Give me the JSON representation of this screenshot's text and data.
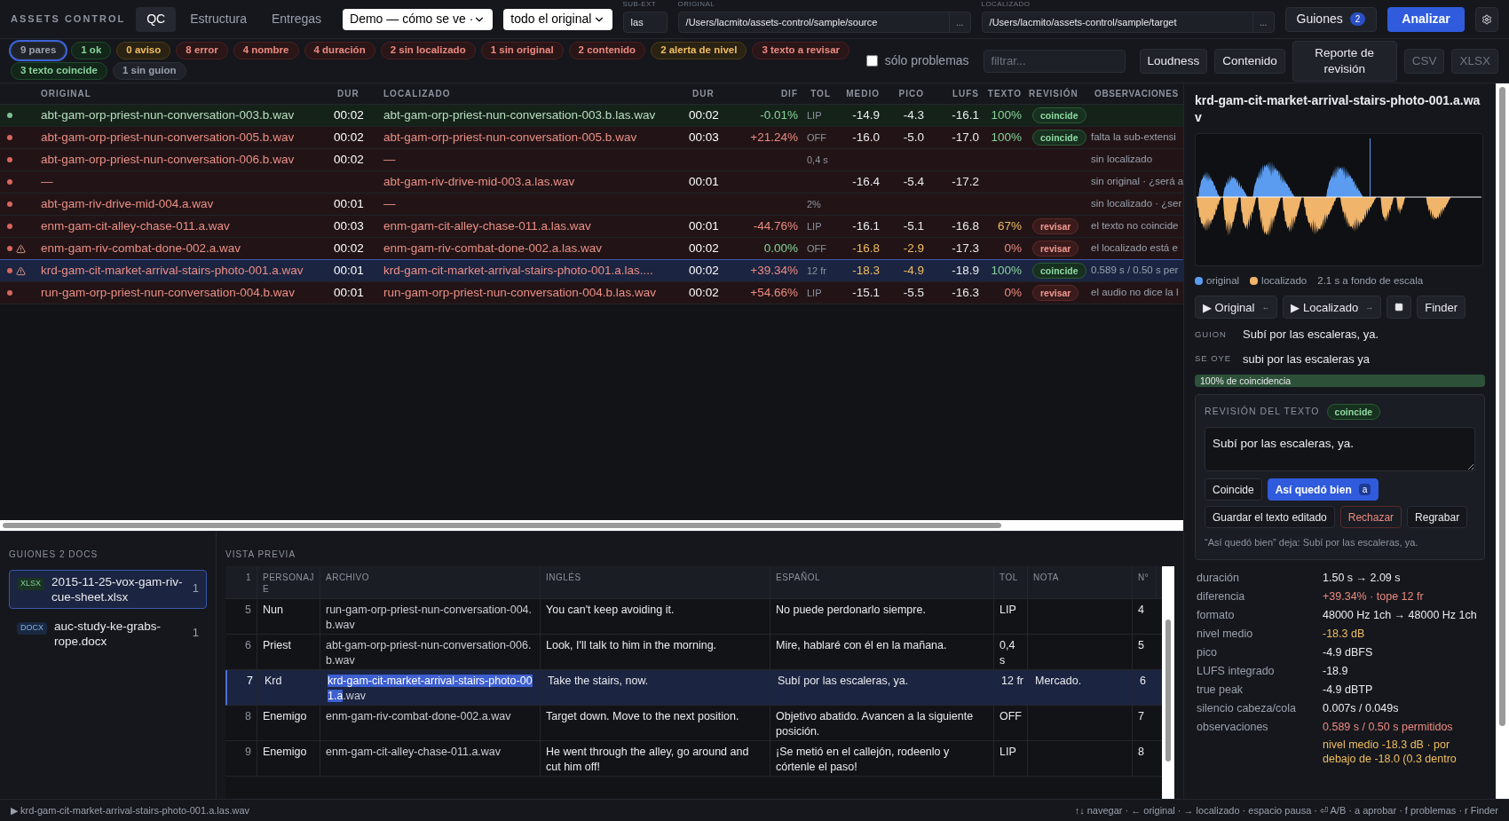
{
  "brand": "ASSETS CONTROL",
  "tabs": [
    {
      "label": "QC",
      "selected": true
    },
    {
      "label": "Estructura",
      "selected": false
    },
    {
      "label": "Entregas",
      "selected": false
    }
  ],
  "project_select": {
    "value": "Demo — cómo se ve ·"
  },
  "scope_select": {
    "value": "todo el original"
  },
  "subext": {
    "label": "SUB-EXT",
    "value": "las"
  },
  "original_path": {
    "label": "ORIGINAL",
    "value": "/Users/lacmito/assets-control/sample/source",
    "browse": "..."
  },
  "localized_path": {
    "label": "LOCALIZADO",
    "value": "/Users/lacmito/assets-control/sample/target",
    "browse": "..."
  },
  "scripts_button": {
    "label": "Guiones",
    "badge": "2"
  },
  "analyze_button": "Analizar",
  "chips": [
    {
      "label": "9 pares",
      "kind": "neutral",
      "selected": true
    },
    {
      "label": "1 ok",
      "kind": "ok",
      "selected": false
    },
    {
      "label": "0 aviso",
      "kind": "warn",
      "selected": false
    },
    {
      "label": "8 error",
      "kind": "error",
      "selected": false
    },
    {
      "label": "4 nombre",
      "kind": "error",
      "selected": false
    },
    {
      "label": "4 duración",
      "kind": "error",
      "selected": false
    },
    {
      "label": "2 sin localizado",
      "kind": "error",
      "selected": false
    },
    {
      "label": "1 sin original",
      "kind": "error",
      "selected": false
    },
    {
      "label": "2 contenido",
      "kind": "error",
      "selected": false
    },
    {
      "label": "2 alerta de nivel",
      "kind": "warn",
      "selected": false
    },
    {
      "label": "3 texto a revisar",
      "kind": "error",
      "selected": false
    },
    {
      "label": "3 texto coincide",
      "kind": "ok",
      "selected": false
    },
    {
      "label": "1 sin guion",
      "kind": "neutral",
      "selected": false
    }
  ],
  "only_problems": {
    "label": "sólo problemas",
    "checked": false
  },
  "filter": {
    "placeholder": "filtrar..."
  },
  "toolbar_buttons": [
    {
      "label": "Loudness",
      "disabled": false
    },
    {
      "label": "Contenido",
      "disabled": false
    },
    {
      "label": "Reporte de revisión",
      "disabled": false
    },
    {
      "label": "CSV",
      "disabled": true
    },
    {
      "label": "XLSX",
      "disabled": true
    }
  ],
  "table": {
    "columns": [
      "ORIGINAL",
      "DUR",
      "LOCALIZADO",
      "DUR",
      "DIF",
      "TOL",
      "MEDIO",
      "PICO",
      "LUFS",
      "TEXTO",
      "REVISIÓN",
      "OBSERVACIONES"
    ],
    "rows": [
      {
        "kind": "ok",
        "warning": false,
        "selected": false,
        "original": "abt-gam-orp-priest-nun-conversation-003.b.wav",
        "dur": "00:02",
        "localized": "abt-gam-orp-priest-nun-conversation-003.b.las.wav",
        "loc_dur": "00:02",
        "dif": {
          "text": "-0.01%",
          "kind": "ok"
        },
        "tol": "LIP",
        "medio": {
          "text": "-14.9",
          "kind": "normal"
        },
        "pico": {
          "text": "-4.3",
          "kind": "normal"
        },
        "lufs": "-16.1",
        "texto": {
          "text": "100%",
          "kind": "ok"
        },
        "revision": {
          "text": "coincide",
          "kind": "ok"
        }
      },
      {
        "kind": "error",
        "warning": false,
        "selected": false,
        "original": "abt-gam-orp-priest-nun-conversation-005.b.wav",
        "dur": "00:02",
        "localized": "abt-gam-orp-priest-nun-conversation-005.b.wav",
        "loc_dur": "00:03",
        "dif": {
          "text": "+21.24%",
          "kind": "error"
        },
        "tol": "OFF",
        "medio": {
          "text": "-16.0",
          "kind": "normal"
        },
        "pico": {
          "text": "-5.0",
          "kind": "normal"
        },
        "lufs": "-17.0",
        "texto": {
          "text": "100%",
          "kind": "ok"
        },
        "revision": {
          "text": "coincide",
          "kind": "ok"
        },
        "notes": "falta la sub-extensi"
      },
      {
        "kind": "error",
        "warning": false,
        "selected": false,
        "original": "abt-gam-orp-priest-nun-conversation-006.b.wav",
        "dur": "00:02",
        "localized": "—",
        "tol": "0,4 s",
        "notes": "sin localizado"
      },
      {
        "kind": "error",
        "warning": false,
        "selected": false,
        "original": "—",
        "localized": "abt-gam-riv-drive-mid-003.a.las.wav",
        "loc_dur": "00:01",
        "medio": {
          "text": "-16.4",
          "kind": "normal"
        },
        "pico": {
          "text": "-5.4",
          "kind": "normal"
        },
        "lufs": "-17.2",
        "notes": "sin original · ¿será a"
      },
      {
        "kind": "error",
        "warning": false,
        "selected": false,
        "original": "abt-gam-riv-drive-mid-004.a.wav",
        "dur": "00:01",
        "localized": "—",
        "tol": "2%",
        "notes": "sin localizado · ¿ser"
      },
      {
        "kind": "error",
        "warning": false,
        "selected": false,
        "original": "enm-gam-cit-alley-chase-011.a.wav",
        "dur": "00:03",
        "localized": "enm-gam-cit-alley-chase-011.a.las.wav",
        "loc_dur": "00:01",
        "dif": {
          "text": "-44.76%",
          "kind": "error"
        },
        "tol": "LIP",
        "medio": {
          "text": "-16.1",
          "kind": "normal"
        },
        "pico": {
          "text": "-5.1",
          "kind": "normal"
        },
        "lufs": "-16.8",
        "texto": {
          "text": "67%",
          "kind": "warn"
        },
        "revision": {
          "text": "revisar",
          "kind": "error"
        },
        "notes": "el texto no coincide"
      },
      {
        "kind": "error",
        "warning": true,
        "selected": false,
        "original": "enm-gam-riv-combat-done-002.a.wav",
        "dur": "00:02",
        "localized": "enm-gam-riv-combat-done-002.a.las.wav",
        "loc_dur": "00:02",
        "dif": {
          "text": "0.00%",
          "kind": "ok"
        },
        "tol": "OFF",
        "medio": {
          "text": "-16.8",
          "kind": "warn"
        },
        "pico": {
          "text": "-2.9",
          "kind": "warn"
        },
        "lufs": "-17.3",
        "texto": {
          "text": "0%",
          "kind": "error"
        },
        "revision": {
          "text": "revisar",
          "kind": "error"
        },
        "notes": "el localizado está e"
      },
      {
        "kind": "error",
        "warning": true,
        "selected": true,
        "original": "krd-gam-cit-market-arrival-stairs-photo-001.a.wav",
        "dur": "00:01",
        "localized": "krd-gam-cit-market-arrival-stairs-photo-001.a.las....",
        "loc_dur": "00:02",
        "dif": {
          "text": "+39.34%",
          "kind": "error"
        },
        "tol": "12 fr",
        "medio": {
          "text": "-18.3",
          "kind": "warn"
        },
        "pico": {
          "text": "-4.9",
          "kind": "warn"
        },
        "lufs": "-18.9",
        "texto": {
          "text": "100%",
          "kind": "ok"
        },
        "revision": {
          "text": "coincide",
          "kind": "ok"
        },
        "notes": "0.589 s / 0.50 s per"
      },
      {
        "kind": "error",
        "warning": false,
        "selected": false,
        "original": "run-gam-orp-priest-nun-conversation-004.b.wav",
        "dur": "00:01",
        "localized": "run-gam-orp-priest-nun-conversation-004.b.las.wav",
        "loc_dur": "00:02",
        "dif": {
          "text": "+54.66%",
          "kind": "error"
        },
        "tol": "LIP",
        "medio": {
          "text": "-15.1",
          "kind": "normal"
        },
        "pico": {
          "text": "-5.5",
          "kind": "normal"
        },
        "lufs": "-16.3",
        "texto": {
          "text": "0%",
          "kind": "error"
        },
        "revision": {
          "text": "revisar",
          "kind": "error"
        },
        "notes": "el audio no dice la l"
      }
    ]
  },
  "scripts": {
    "title": "GUIONES 2 DOCS",
    "docs": [
      {
        "kind": "xlsx",
        "badge": "XLSX",
        "name": "2015-11-25-vox-gam-riv-cue-sheet.xlsx",
        "count": "1",
        "selected": true
      },
      {
        "kind": "docx",
        "badge": "DOCX",
        "name": "auc-study-ke-grabs-rope.docx",
        "count": "1",
        "selected": false
      }
    ]
  },
  "preview": {
    "title": "VISTA PREVIA",
    "columns": [
      "1",
      "PERSONAJE",
      "ARCHIVO",
      "INGLÉS",
      "ESPAÑOL",
      "TOL",
      "NOTA",
      "N°"
    ],
    "rows": [
      {
        "selected": false,
        "n": "5",
        "character": "Nun",
        "file": [
          {
            "text": "run-gam-orp-priest-nun-conversation-004.b.wav",
            "highlighted": false
          }
        ],
        "english": "You can't keep avoiding it.",
        "spanish": "No puede perdonarlo siempre.",
        "tol": "LIP",
        "number": "4"
      },
      {
        "selected": false,
        "n": "6",
        "character": "Priest",
        "file": [
          {
            "text": "abt-gam-orp-priest-nun-conversation-006.b.wav",
            "highlighted": false
          }
        ],
        "english": "Look, I'll talk to him in the morning.",
        "spanish": "Mire, hablaré con él en la mañana.",
        "tol": "0,4 s",
        "number": "5"
      },
      {
        "selected": true,
        "n": "7",
        "character": "Krd",
        "file": [
          {
            "text": "krd-gam-cit-market-arrival-stairs-photo-001.a",
            "highlighted": true
          },
          {
            "text": ".wav",
            "highlighted": false
          }
        ],
        "english": "Take the stairs, now.",
        "spanish": "Subí por las escaleras, ya.",
        "tol": "12 fr",
        "note": "Mercado.",
        "number": "6"
      },
      {
        "selected": false,
        "n": "8",
        "character": "Enemigo",
        "file": [
          {
            "text": "enm-gam-riv-combat-done-002.a.wav",
            "highlighted": false
          }
        ],
        "english": "Target down. Move to the next position.",
        "spanish": "Objetivo abatido. Avancen a la siguiente posición.",
        "tol": "OFF",
        "number": "7"
      },
      {
        "selected": false,
        "n": "9",
        "character": "Enemigo",
        "file": [
          {
            "text": "enm-gam-cit-alley-chase-011.a.wav",
            "highlighted": false
          }
        ],
        "english": "He went through the alley, go around and cut him off!",
        "spanish": "¡Se metió en el callejón, rodeenlo y córtenle el paso!",
        "tol": "LIP",
        "number": "8"
      }
    ]
  },
  "detail": {
    "title": "krd-gam-cit-market-arrival-stairs-photo-001.a.wav",
    "legend": [
      {
        "label": "original",
        "color": "#5b9cf0"
      },
      {
        "label": "localizado",
        "color": "#f0b46a"
      }
    ],
    "scale_note": "2.1 s a fondo de escala",
    "players": [
      {
        "kind": "play",
        "label": "▶ Original",
        "key": "←"
      },
      {
        "kind": "play",
        "label": "▶ Localizado",
        "key": "→"
      },
      {
        "kind": "stop"
      },
      {
        "kind": "text",
        "label": "Finder"
      }
    ],
    "script_line": {
      "label": "GUION",
      "text": "Subí por las escaleras, ya."
    },
    "heard_line": {
      "label": "SE OYE",
      "text": "subi por las escaleras ya"
    },
    "match": {
      "level": 1.0,
      "label": "100% de coincidencia"
    },
    "review": {
      "title": "REVISIÓN DEL TEXTO",
      "badge": "coincide",
      "text": "Subí por las escaleras, ya.",
      "buttons": [
        {
          "label": "Coincide",
          "kind": "plain",
          "selected": false
        },
        {
          "label": "Así quedó bien",
          "kind": "plain",
          "selected": true,
          "key": "a"
        },
        {
          "label": "Guardar el texto editado",
          "kind": "plain",
          "selected": false
        },
        {
          "label": "Rechazar",
          "kind": "danger",
          "selected": false
        },
        {
          "label": "Regrabar",
          "kind": "plain",
          "selected": false
        }
      ],
      "note": "“Así quedó bien” deja: Subí por las escaleras, ya."
    },
    "stats": [
      {
        "key": "duración",
        "values": [
          {
            "text": "1.50 s → 2.09 s",
            "kind": "normal"
          }
        ]
      },
      {
        "key": "diferencia",
        "values": [
          {
            "text": "+39.34% · tope 12 fr",
            "kind": "error"
          }
        ]
      },
      {
        "key": "formato",
        "values": [
          {
            "text": "48000 Hz 1ch → 48000 Hz 1ch",
            "kind": "normal"
          }
        ]
      },
      {
        "key": "nivel medio",
        "values": [
          {
            "text": "-18.3 dB",
            "kind": "warn"
          }
        ]
      },
      {
        "key": "pico",
        "values": [
          {
            "text": "-4.9 dBFS",
            "kind": "normal"
          }
        ]
      },
      {
        "key": "LUFS integrado",
        "values": [
          {
            "text": "-18.9",
            "kind": "normal"
          }
        ]
      },
      {
        "key": "true peak",
        "values": [
          {
            "text": "-4.9 dBTP",
            "kind": "normal"
          }
        ]
      },
      {
        "key": "silencio cabeza/cola",
        "values": [
          {
            "text": "0.007s / 0.049s",
            "kind": "normal"
          }
        ]
      },
      {
        "key": "observaciones",
        "values": [
          {
            "text": "0.589 s / 0.50 s permitidos",
            "kind": "error"
          },
          {
            "text": "nivel medio -18.3 dB · por debajo de -18.0 (0.3 dentro",
            "kind": "warn"
          }
        ]
      }
    ]
  },
  "status_bar": {
    "current": "▶ krd-gam-cit-market-arrival-stairs-photo-001.a.las.wav",
    "shortcuts": "↑↓ navegar · ← original · → localizado · espacio pausa · ⏎ A/B · a aprobar · f problemas · r Finder"
  }
}
